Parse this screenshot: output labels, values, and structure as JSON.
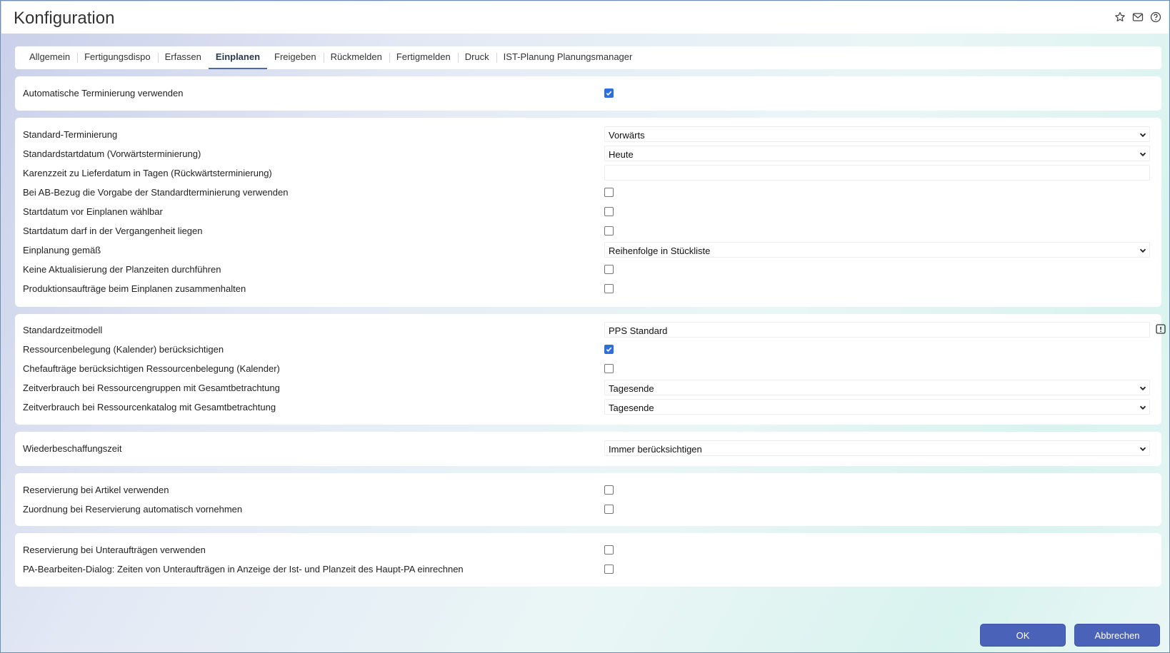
{
  "window": {
    "title": "Konfiguration",
    "icons": [
      "star-icon",
      "mail-icon",
      "help-icon"
    ]
  },
  "tabs": [
    {
      "label": "Allgemein",
      "active": false
    },
    {
      "label": "Fertigungsdispo",
      "active": false
    },
    {
      "label": "Erfassen",
      "active": false
    },
    {
      "label": "Einplanen",
      "active": true
    },
    {
      "label": "Freigeben",
      "active": false
    },
    {
      "label": "Rückmelden",
      "active": false
    },
    {
      "label": "Fertigmelden",
      "active": false
    },
    {
      "label": "Druck",
      "active": false
    },
    {
      "label": "IST-Planung Planungsmanager",
      "active": false
    }
  ],
  "panel1": {
    "auto_terminierung": {
      "label": "Automatische Terminierung verwenden",
      "checked": true
    }
  },
  "panel2": {
    "standard_terminierung": {
      "label": "Standard-Terminierung",
      "value": "Vorwärts"
    },
    "standardstartdatum": {
      "label": "Standardstartdatum (Vorwärtsterminierung)",
      "value": "Heute"
    },
    "karenzzeit": {
      "label": "Karenzzeit zu Lieferdatum in Tagen (Rückwärtsterminierung)",
      "value": ""
    },
    "ab_bezug": {
      "label": "Bei AB-Bezug die Vorgabe der Standardterminierung verwenden",
      "checked": false
    },
    "startdatum_waehlbar": {
      "label": "Startdatum vor Einplanen wählbar",
      "checked": false
    },
    "startdatum_vergangenheit": {
      "label": "Startdatum darf in der Vergangenheit liegen",
      "checked": false
    },
    "einplanung_gemaess": {
      "label": "Einplanung gemäß",
      "value": "Reihenfolge in Stückliste"
    },
    "keine_aktualisierung": {
      "label": "Keine Aktualisierung der Planzeiten durchführen",
      "checked": false
    },
    "zusammenhalten": {
      "label": "Produktionsaufträge beim Einplanen zusammenhalten",
      "checked": false
    }
  },
  "panel3": {
    "standardzeitmodell": {
      "label": "Standardzeitmodell",
      "value": "PPS Standard"
    },
    "ressourcenbelegung": {
      "label": "Ressourcenbelegung (Kalender) berücksichtigen",
      "checked": true
    },
    "chefauftraege": {
      "label": "Chefaufträge berücksichtigen Ressourcenbelegung (Kalender)",
      "checked": false
    },
    "zeitverbrauch_gruppen": {
      "label": "Zeitverbrauch bei Ressourcengruppen mit Gesamtbetrachtung",
      "value": "Tagesende"
    },
    "zeitverbrauch_katalog": {
      "label": "Zeitverbrauch bei Ressourcenkatalog mit Gesamtbetrachtung",
      "value": "Tagesende"
    }
  },
  "panel4": {
    "wiederbeschaffungszeit": {
      "label": "Wiederbeschaffungszeit",
      "value": "Immer berücksichtigen"
    }
  },
  "panel5": {
    "reservierung_artikel": {
      "label": "Reservierung bei Artikel verwenden",
      "checked": false
    },
    "zuordnung_automatisch": {
      "label": "Zuordnung bei Reservierung automatisch vornehmen",
      "checked": false
    }
  },
  "panel6": {
    "reservierung_unterauftraege": {
      "label": "Reservierung bei Unteraufträgen verwenden",
      "checked": false
    },
    "pa_bearbeiten": {
      "label": "PA-Bearbeiten-Dialog: Zeiten von Unteraufträgen in Anzeige der Ist- und Planzeit des Haupt-PA einrechnen",
      "checked": false
    }
  },
  "footer": {
    "ok_label": "OK",
    "cancel_label": "Abbrechen"
  },
  "colors": {
    "accent": "#2f6fdc",
    "button": "#4a63b8",
    "active_tab_underline": "#4a6aa8"
  }
}
